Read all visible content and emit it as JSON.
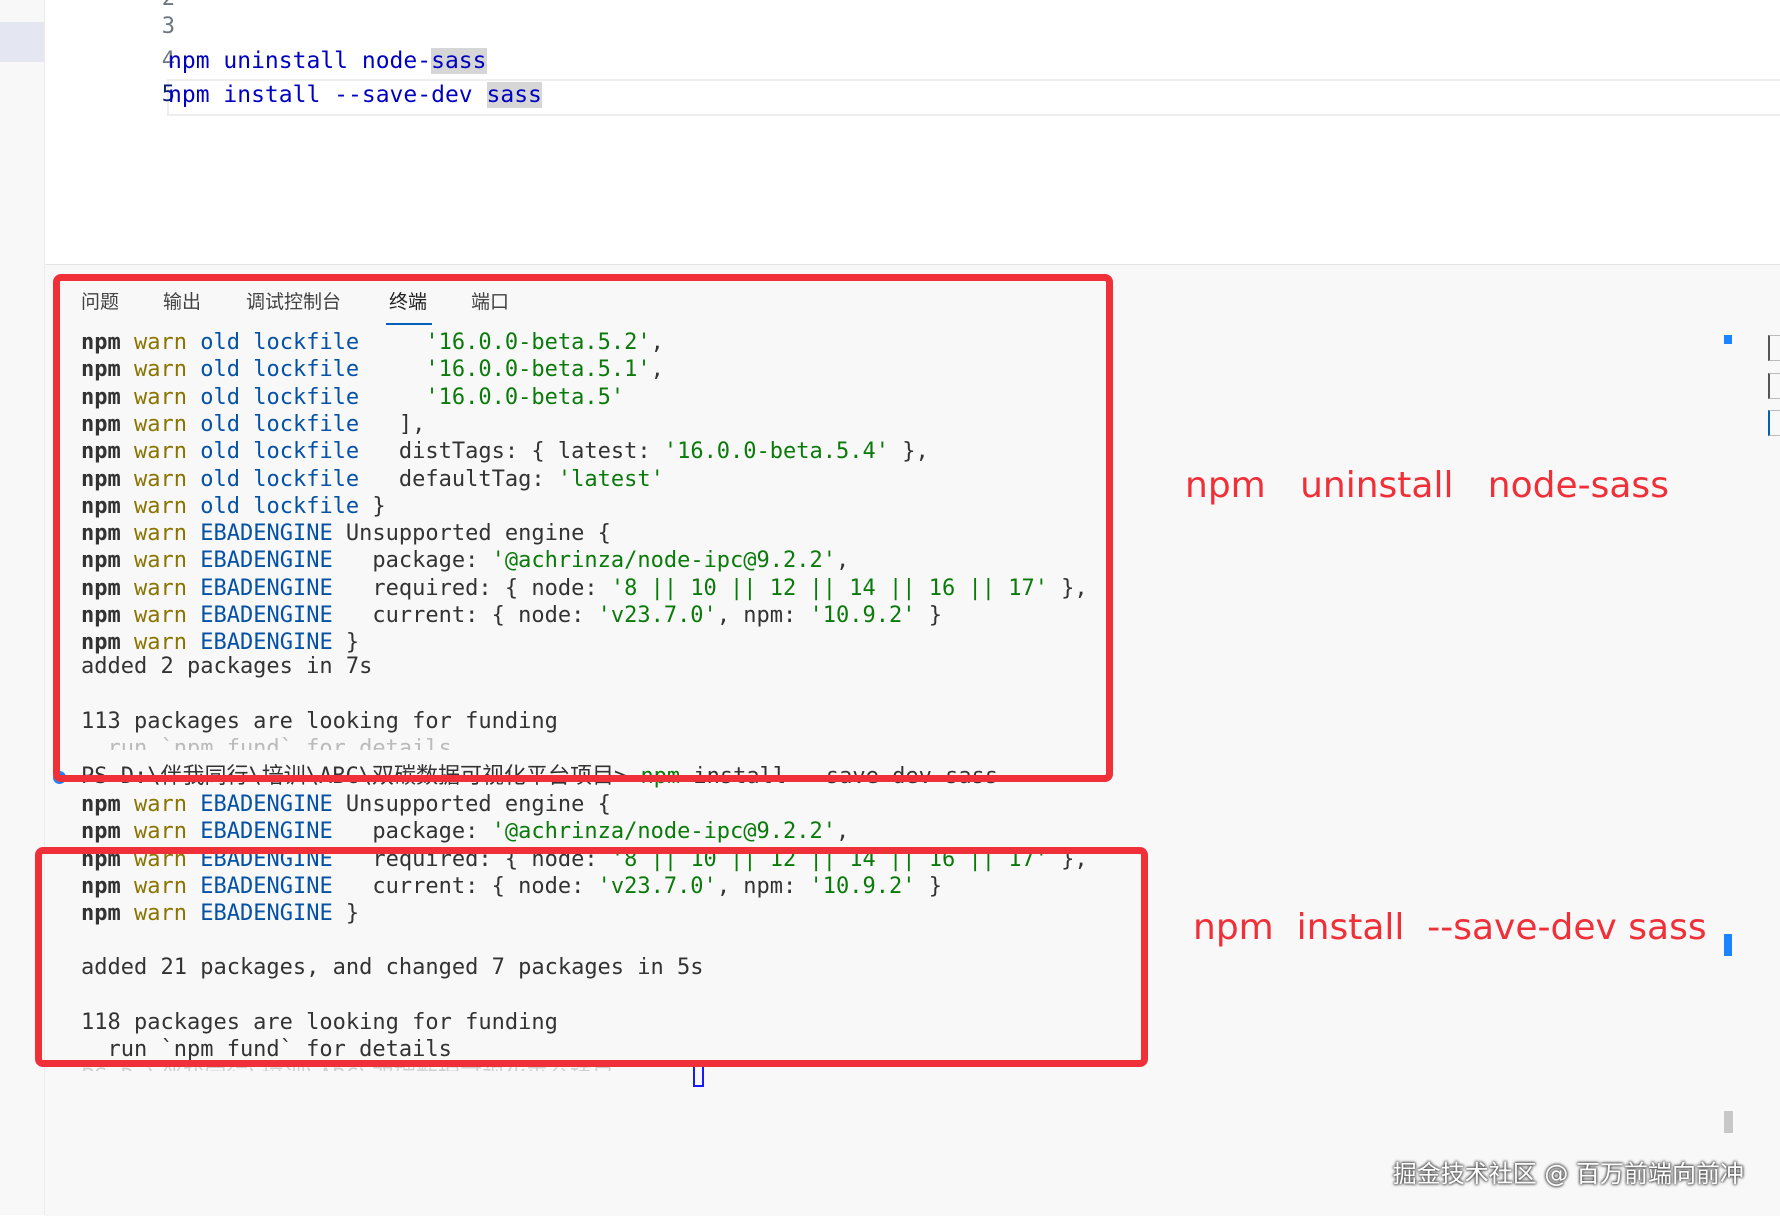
{
  "editor": {
    "lines": [
      {
        "num": "2",
        "text": ""
      },
      {
        "num": "3",
        "text": ""
      },
      {
        "num": "4",
        "pre": "npm uninstall node-",
        "hl": "sass"
      },
      {
        "num": "5",
        "pre": "npm install --save-dev ",
        "hl": "sass"
      }
    ]
  },
  "panel": {
    "tabs": [
      "问题",
      "输出",
      "调试控制台",
      "终端",
      "端口"
    ],
    "active_tab": "终端"
  },
  "terminal": {
    "block1": [
      {
        "p": "npm",
        "w": "warn",
        "k": "old lockfile",
        "rest_pre": "     ",
        "str": "'16.0.0-beta.5.2'",
        "rest_post": ","
      },
      {
        "p": "npm",
        "w": "warn",
        "k": "old lockfile",
        "rest_pre": "     ",
        "str": "'16.0.0-beta.5.1'",
        "rest_post": ","
      },
      {
        "p": "npm",
        "w": "warn",
        "k": "old lockfile",
        "rest_pre": "     ",
        "str": "'16.0.0-beta.5'",
        "rest_post": ""
      },
      {
        "p": "npm",
        "w": "warn",
        "k": "old lockfile",
        "rest_pre": "   ],",
        "str": "",
        "rest_post": ""
      },
      {
        "p": "npm",
        "w": "warn",
        "k": "old lockfile",
        "rest_pre": "   distTags: { latest: ",
        "str": "'16.0.0-beta.5.4'",
        "rest_post": " },"
      },
      {
        "p": "npm",
        "w": "warn",
        "k": "old lockfile",
        "rest_pre": "   defaultTag: ",
        "str": "'latest'",
        "rest_post": ""
      },
      {
        "p": "npm",
        "w": "warn",
        "k": "old lockfile",
        "rest_pre": " }",
        "str": "",
        "rest_post": ""
      },
      {
        "p": "npm",
        "w": "warn",
        "k": "EBADENGINE",
        "rest_pre": " Unsupported engine {",
        "str": "",
        "rest_post": ""
      },
      {
        "p": "npm",
        "w": "warn",
        "k": "EBADENGINE",
        "rest_pre": "   package: ",
        "str": "'@achrinza/node-ipc@9.2.2'",
        "rest_post": ","
      },
      {
        "p": "npm",
        "w": "warn",
        "k": "EBADENGINE",
        "rest_pre": "   required: { node: ",
        "str": "'8 || 10 || 12 || 14 || 16 || 17'",
        "rest_post": " },"
      },
      {
        "p": "npm",
        "w": "warn",
        "k": "EBADENGINE",
        "rest_pre": "   current: { node: ",
        "str": "'v23.7.0'",
        "rest_post": ", npm: ",
        "str2": "'10.9.2'",
        "rest_post2": " }"
      },
      {
        "p": "npm",
        "w": "warn",
        "k": "EBADENGINE",
        "rest_pre": " }",
        "str": "",
        "rest_post": ""
      }
    ],
    "added1": "added 2 packages in 7s",
    "funding1": "113 packages are looking for funding",
    "fund_hint1": "  run `npm fund` for details",
    "prompt": "PS D:\\伴我同行\\培训\\ABC\\双碳数据可视化平台项目> ",
    "command": "npm install --save-dev sass",
    "block2": [
      {
        "p": "npm",
        "w": "warn",
        "k": "EBADENGINE",
        "rest_pre": " Unsupported engine {",
        "str": "",
        "rest_post": ""
      },
      {
        "p": "npm",
        "w": "warn",
        "k": "EBADENGINE",
        "rest_pre": "   package: ",
        "str": "'@achrinza/node-ipc@9.2.2'",
        "rest_post": ","
      },
      {
        "p": "npm",
        "w": "warn",
        "k": "EBADENGINE",
        "rest_pre": "   required: { node: ",
        "str": "'8 || 10 || 12 || 14 || 16 || 17'",
        "rest_post": " },"
      },
      {
        "p": "npm",
        "w": "warn",
        "k": "EBADENGINE",
        "rest_pre": "   current: { node: ",
        "str": "'v23.7.0'",
        "rest_post": ", npm: ",
        "str2": "'10.9.2'",
        "rest_post2": " }"
      },
      {
        "p": "npm",
        "w": "warn",
        "k": "EBADENGINE",
        "rest_pre": " }",
        "str": "",
        "rest_post": ""
      }
    ],
    "added2": "added 21 packages, and changed 7 packages in 5s",
    "funding2": "118 packages are looking for funding",
    "fund_hint2": "  run `npm fund` for details",
    "prompt_partial": "PS D:\\伴我同行\\培训\\ABC\\双碳数据可视化平台项目> "
  },
  "annotations": {
    "note1": "npm   uninstall   node-sass",
    "note2": "npm  install  --save-dev sass"
  },
  "watermark": "掘金技术社区 @ 百万前端向前冲",
  "colors": {
    "annotation_red": "#f03039",
    "accent_blue": "#005fb8",
    "warn_yellow": "#8a7400",
    "string_green": "#0a7a0a",
    "keyword_blue": "#0451a5"
  }
}
